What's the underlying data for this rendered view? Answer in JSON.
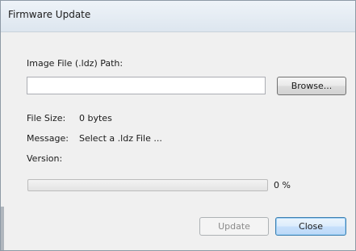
{
  "window": {
    "title": "Firmware Update"
  },
  "form": {
    "path_label": "Image File (.ldz) Path:",
    "path_value": "",
    "browse_label": "Browse...",
    "file_size_label": "File Size:",
    "file_size_value": "0 bytes",
    "message_label": "Message:",
    "message_value": "Select a .ldz File ...",
    "version_label": "Version:",
    "version_value": "",
    "progress_fraction": 0,
    "progress_text": "0 %"
  },
  "buttons": {
    "update_label": "Update",
    "update_enabled": false,
    "close_label": "Close"
  },
  "colors": {
    "default_button_border": "#3c7fb1",
    "disabled_text": "#8a8a8a"
  }
}
